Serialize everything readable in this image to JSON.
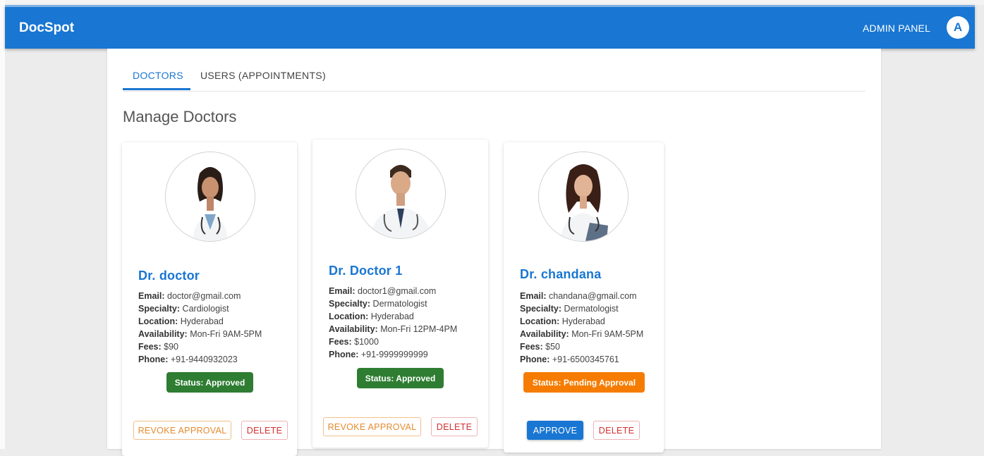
{
  "app": {
    "brand": "DocSpot",
    "admin_label": "ADMIN PANEL",
    "avatar_initial": "A"
  },
  "tabs": [
    {
      "label": "DOCTORS",
      "active": true
    },
    {
      "label": "USERS (APPOINTMENTS)",
      "active": false
    }
  ],
  "heading": "Manage Doctors",
  "field_labels": {
    "email": "Email:",
    "specialty": "Specialty:",
    "location": "Location:",
    "availability": "Availability:",
    "fees": "Fees:",
    "phone": "Phone:"
  },
  "doctors": [
    {
      "name": "Dr. doctor",
      "email": "doctor@gmail.com",
      "specialty": "Cardiologist",
      "location": "Hyderabad",
      "availability": "Mon-Fri 9AM-5PM",
      "fees": "$90",
      "phone": "+91-9440932023",
      "status": "Status: Approved",
      "status_color": "#2e7d32",
      "primary_action": "REVOKE APPROVAL",
      "delete_label": "DELETE"
    },
    {
      "name": "Dr. Doctor 1",
      "email": "doctor1@gmail.com",
      "specialty": "Dermatologist",
      "location": "Hyderabad",
      "availability": "Mon-Fri 12PM-4PM",
      "fees": "$1000",
      "phone": "+91-9999999999",
      "status": "Status: Approved",
      "status_color": "#2e7d32",
      "primary_action": "REVOKE APPROVAL",
      "delete_label": "DELETE"
    },
    {
      "name": "Dr. chandana",
      "email": "chandana@gmail.com",
      "specialty": "Dermatologist",
      "location": "Hyderabad",
      "availability": "Mon-Fri 9AM-5PM",
      "fees": "$50",
      "phone": "+91-6500345761",
      "status": "Status: Pending Approval",
      "status_color": "#f57c00",
      "primary_action": "APPROVE",
      "delete_label": "DELETE"
    }
  ],
  "colors": {
    "primary": "#1976d2",
    "approved": "#2e7d32",
    "pending": "#f57c00",
    "danger": "#d32f2f",
    "warning": "#e48a2e"
  }
}
